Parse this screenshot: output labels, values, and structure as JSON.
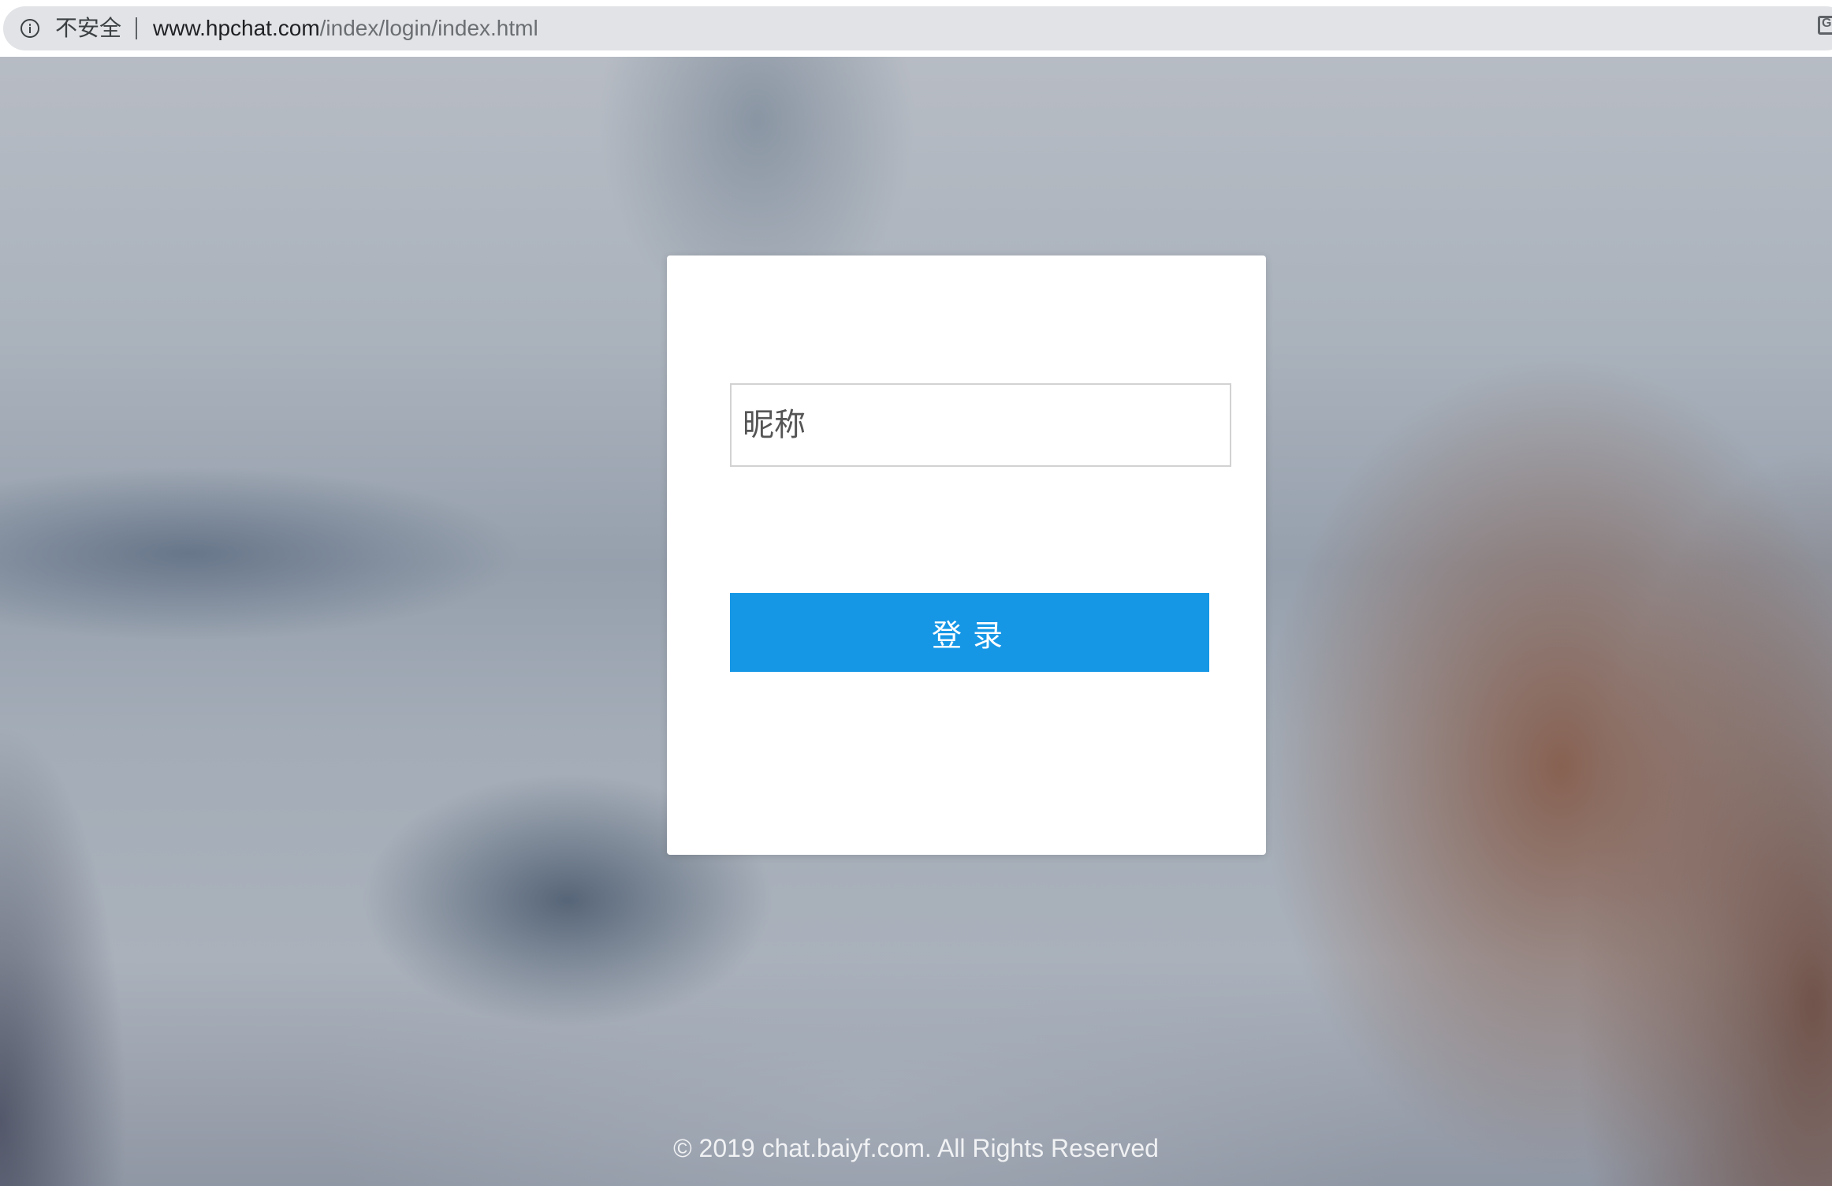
{
  "browser": {
    "security_label": "不安全",
    "url_host": "www.hpchat.com",
    "url_path": "/index/login/index.html",
    "extension_icon": "google-translate-icon",
    "info_icon": "info-icon"
  },
  "login": {
    "nickname_placeholder": "昵称",
    "nickname_value": "",
    "login_button_label": "登录"
  },
  "footer": {
    "copyright": "© 2019 chat.baiyf.com. All Rights Reserved"
  },
  "colors": {
    "button": "#1697e6",
    "card": "#ffffff",
    "omnibox": "#e1e3e6"
  }
}
